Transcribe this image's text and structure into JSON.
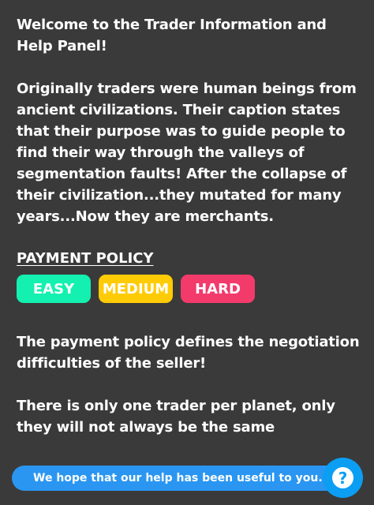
{
  "panel": {
    "welcome": "Welcome to the Trader Information and Help Panel!",
    "origin": "Originally traders were human beings from ancient civilizations. Their caption states that their purpose was to guide people to find their way through the valleys of segmentation faults! After the collapse of their civilization...they mutated for many years...Now they are merchants.",
    "policy_title": "PAYMENT POLICY",
    "policy_levels": [
      {
        "label": "EASY",
        "color": "#13f0b0"
      },
      {
        "label": "MEDIUM",
        "color": "#ffcb05"
      },
      {
        "label": "HARD",
        "color": "#f23a6b"
      }
    ],
    "policy_description": "The payment policy defines the negotiation difficulties of the seller!",
    "trader_note": "There is only one trader per planet, only they will not always be the same"
  },
  "footer": {
    "message": "We hope that our help has been useful to you.",
    "bar_color": "#2a96f1"
  },
  "help_button": {
    "icon": "question-icon",
    "glyph": "?",
    "color": "#0b9ef3"
  }
}
